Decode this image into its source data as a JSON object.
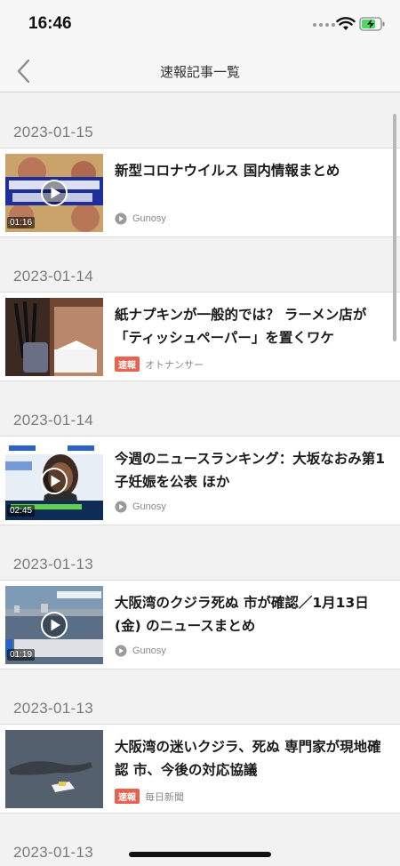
{
  "status": {
    "time": "16:46"
  },
  "nav": {
    "title": "速報記事一覧"
  },
  "sections": [
    {
      "date": "2023-01-15",
      "article": {
        "title": "新型コロナウイルス 国内情報まとめ",
        "source": "Gunosy",
        "duration": "01:16",
        "badge": "",
        "video": true
      }
    },
    {
      "date": "2023-01-14",
      "article": {
        "title": "紙ナプキンが一般的では？ ラーメン店が「ティッシュペーパー」を置くワケ",
        "source": "オトナンサー",
        "duration": "",
        "badge": "速報",
        "video": false
      }
    },
    {
      "date": "2023-01-14",
      "article": {
        "title": "今週のニュースランキング：大坂なおみ第1子妊娠を公表 ほか",
        "source": "Gunosy",
        "duration": "02:45",
        "badge": "",
        "video": true
      }
    },
    {
      "date": "2023-01-13",
      "article": {
        "title": "大阪湾のクジラ死ぬ 市が確認／1月13日 (金) のニュースまとめ",
        "source": "Gunosy",
        "duration": "01:19",
        "badge": "",
        "video": true
      }
    },
    {
      "date": "2023-01-13",
      "article": {
        "title": "大阪湾の迷いクジラ、死ぬ 専門家が現地確認 市、今後の対応協議",
        "source": "毎日新聞",
        "duration": "",
        "badge": "速報",
        "video": false
      }
    },
    {
      "date": "2023-01-13",
      "article": null
    }
  ],
  "colors": {
    "accent_badge": "#e8624f",
    "date_text": "#7a7a7a"
  }
}
